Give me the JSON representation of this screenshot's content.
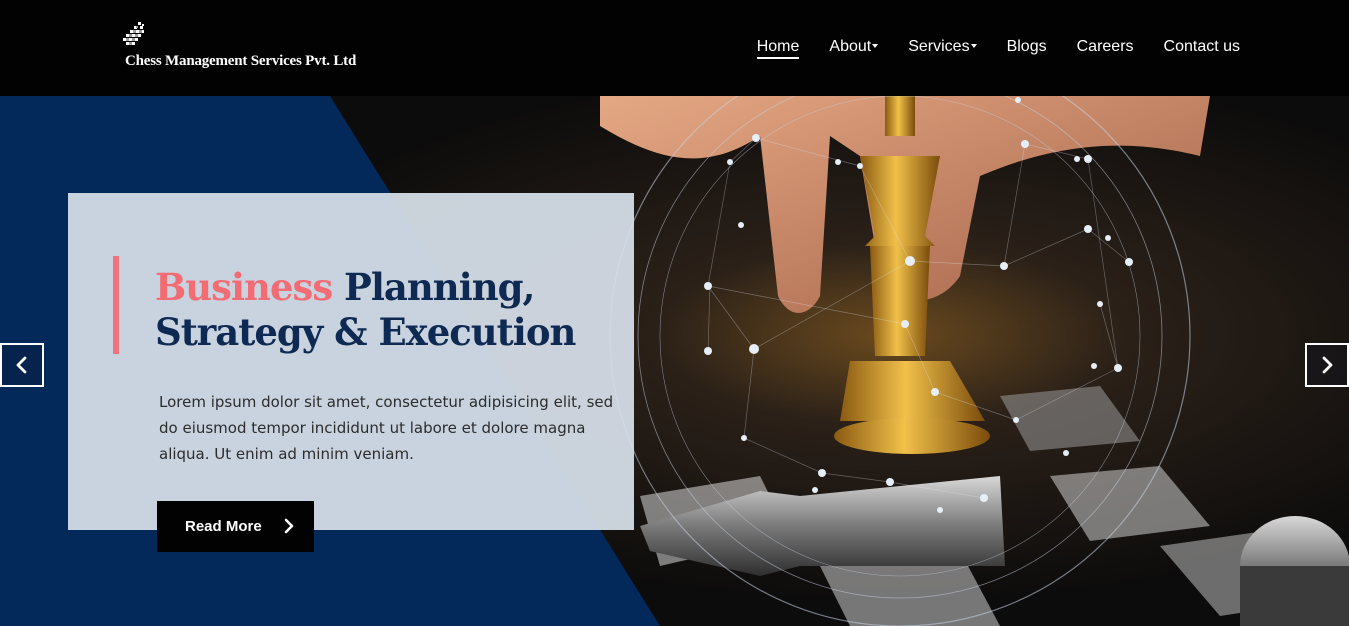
{
  "brand": {
    "name": "Chess Management Services Pvt. Ltd",
    "logo_icon": "chessboard-logo-icon"
  },
  "nav": {
    "items": [
      {
        "label": "Home",
        "active": true,
        "dropdown": false
      },
      {
        "label": "About",
        "active": false,
        "dropdown": true
      },
      {
        "label": "Services",
        "active": false,
        "dropdown": true
      },
      {
        "label": "Blogs",
        "active": false,
        "dropdown": false
      },
      {
        "label": "Careers",
        "active": false,
        "dropdown": false
      },
      {
        "label": "Contact us",
        "active": false,
        "dropdown": false
      }
    ]
  },
  "hero": {
    "title_highlight": "Business",
    "title_rest_line1": " Planning,",
    "title_line2": "Strategy & Execution",
    "description": "Lorem ipsum dolor sit amet, consectetur adipisicing elit, sed do eiusmod tempor incididunt ut labore et dolore magna aliqua. Ut enim ad minim veniam.",
    "cta_label": "Read More",
    "cta_icon": "chevron-right-icon",
    "prev_icon": "chevron-left-icon",
    "next_icon": "chevron-right-icon"
  },
  "colors": {
    "header_bg": "#020202",
    "navy": "#0f2a52",
    "accent": "#f36c74",
    "card_bg": "#d6dee8"
  }
}
